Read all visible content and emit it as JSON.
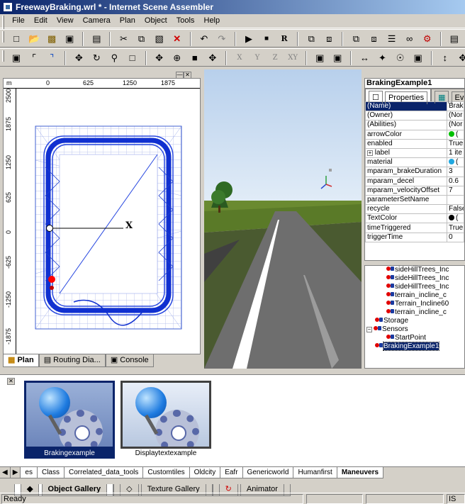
{
  "window": {
    "title": "FreewayBraking.wrl * - Internet Scene Assembler"
  },
  "menu": [
    "File",
    "Edit",
    "View",
    "Camera",
    "Plan",
    "Object",
    "Tools",
    "Help"
  ],
  "toolbar_letters": [
    "X",
    "Y",
    "Z",
    "XY"
  ],
  "toolbar_r": "R",
  "plan": {
    "ruler_top": [
      "m",
      "0",
      "625",
      "1250",
      "1875"
    ],
    "ruler_left": [
      "2500",
      "1875",
      "1250",
      "625",
      "0",
      "-625",
      "-1250",
      "-1875"
    ],
    "axis_label": "X",
    "tabs": [
      "Plan",
      "Routing Dia...",
      "Console"
    ]
  },
  "properties": {
    "object_name": "BrakingExample1",
    "tabs": [
      "Properties",
      "Events"
    ],
    "rows": [
      {
        "name": "(Name)",
        "value": "Brak"
      },
      {
        "name": "(Owner)",
        "value": "(Nor"
      },
      {
        "name": "(Abilities)",
        "value": "(Nor"
      },
      {
        "name": "arrowColor",
        "value": "("
      },
      {
        "name": "enabled",
        "value": "True"
      },
      {
        "name": "label",
        "value": "1 ite"
      },
      {
        "name": "material",
        "value": "("
      },
      {
        "name": "mparam_brakeDuration",
        "value": "3"
      },
      {
        "name": "mparam_decel",
        "value": "0.6"
      },
      {
        "name": "mparam_velocityOffset",
        "value": "7"
      },
      {
        "name": "parameterSetName",
        "value": ""
      },
      {
        "name": "recycle",
        "value": "False"
      },
      {
        "name": "TextColor",
        "value": "("
      },
      {
        "name": "timeTriggered",
        "value": "True"
      },
      {
        "name": "triggerTime",
        "value": "0"
      }
    ],
    "colors": {
      "arrowColor": "#00c000",
      "material": "#20a8e0",
      "TextColor": "#000000"
    }
  },
  "tree": [
    {
      "label": "sideHillTrees_Inc",
      "indent": 2
    },
    {
      "label": "sideHillTrees_Inc",
      "indent": 2
    },
    {
      "label": "sideHillTrees_Inc",
      "indent": 2
    },
    {
      "label": "terrain_incline_c",
      "indent": 2
    },
    {
      "label": "Terrain_Incline60",
      "indent": 2
    },
    {
      "label": "terrain_incline_c",
      "indent": 2
    },
    {
      "label": "Storage",
      "indent": 1
    },
    {
      "label": "Sensors",
      "indent": 0
    },
    {
      "label": "StartPoint",
      "indent": 2
    },
    {
      "label": "BrakingExample1",
      "indent": 1
    }
  ],
  "gallery": {
    "items": [
      "Brakingexample",
      "Displaytextexample"
    ],
    "categories": [
      "es",
      "Class",
      "Correlated_data_tools",
      "Customtiles",
      "Oldcity",
      "Eafr",
      "Genericworld",
      "Humanfirst",
      "Maneuvers"
    ],
    "tabs": [
      "Object Gallery",
      "Texture Gallery",
      "Animator"
    ]
  },
  "status": {
    "text": "Ready",
    "right": "IS"
  }
}
